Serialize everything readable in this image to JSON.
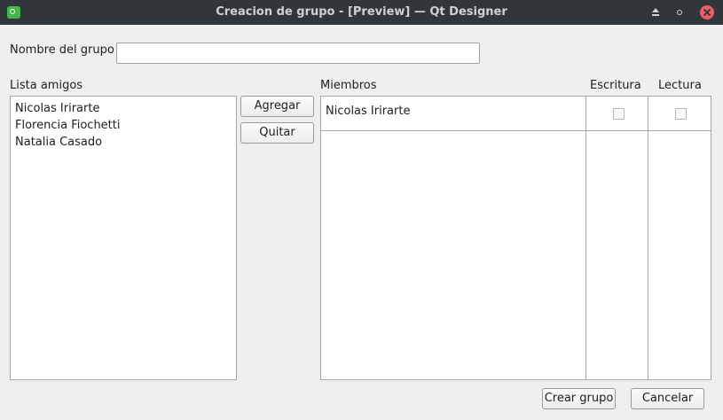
{
  "window": {
    "title": "Creacion de grupo - [Preview] — Qt Designer",
    "controls": [
      "keep-above-icon",
      "restore-icon",
      "close-icon"
    ]
  },
  "form": {
    "group_name_label": "Nombre del grupo",
    "group_name_value": "",
    "friends_label": "Lista amigos",
    "friends": [
      "Nicolas Irirarte",
      "Florencia Fiochetti",
      "Natalia Casado"
    ],
    "add_button": "Agregar",
    "remove_button": "Quitar",
    "members_label": "Miembros",
    "write_label": "Escritura",
    "read_label": "Lectura",
    "members": [
      {
        "name": "Nicolas Irirarte",
        "write": false,
        "read": false
      }
    ],
    "create_button": "Crear grupo",
    "cancel_button": "Cancelar"
  },
  "colors": {
    "titlebar": "#31363b",
    "window_bg": "#efefef",
    "close_button": "#ed5c6a",
    "app_icon": "#45b549"
  }
}
